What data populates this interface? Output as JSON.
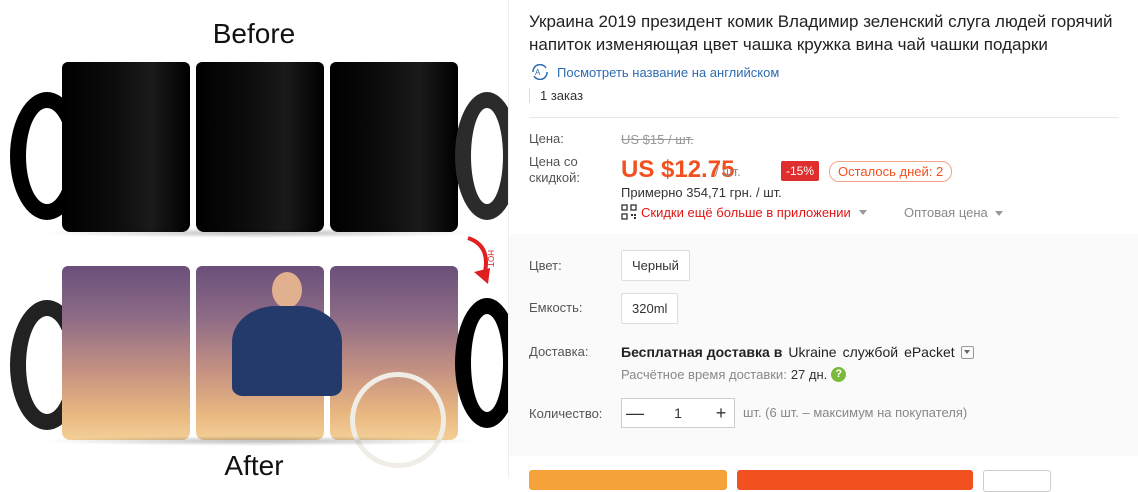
{
  "gallery": {
    "before_label": "Before",
    "after_label": "After",
    "hot_label": "HOT"
  },
  "product": {
    "title": "Украина 2019 президент комик Владимир зеленский слуга людей горячий напиток изменяющая цвет чашка кружка вина чай чашки подарки",
    "translate_link": "Посмотреть название на английском",
    "orders": "1 заказ"
  },
  "pricing": {
    "price_label": "Цена:",
    "old_price": "US $15 / шт.",
    "discount_label_line1": "Цена со",
    "discount_label_line2": "скидкой:",
    "price": "US $12.75",
    "unit": "/ шт.",
    "discount_badge": "-15%",
    "days_left": "Осталось дней: 2",
    "approx": "Примерно 354,71 грн. / шт.",
    "app_deals": "Скидки ещё больше в приложении",
    "wholesale": "Оптовая цена"
  },
  "options": {
    "color_label": "Цвет:",
    "color_value": "Черный",
    "capacity_label": "Емкость:",
    "capacity_value": "320ml"
  },
  "shipping": {
    "label": "Доставка:",
    "free_text": "Бесплатная доставка в",
    "country": "Ukraine",
    "service_text": "службой",
    "carrier": "ePacket",
    "eta_label": "Расчётное время доставки:",
    "eta_value": "27 дн."
  },
  "quantity": {
    "label": "Количество:",
    "value": "1",
    "minus": "—",
    "plus": "+",
    "note": "шт. (6 шт. – максимум на покупателя)"
  },
  "colors": {
    "accent": "#f2501f",
    "discount_badge": "#e02d2d",
    "link": "#2e6bb0",
    "help_icon": "#7bb93b",
    "buy_now": "#f5a23a"
  }
}
